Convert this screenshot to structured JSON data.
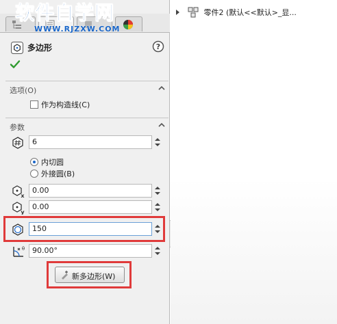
{
  "watermark": {
    "title": "软件自学网",
    "url": "WWW.RJZXW.COM"
  },
  "feature": {
    "title": "多边形"
  },
  "options": {
    "header": "选项(O)",
    "construction_label": "作为构造线(C)"
  },
  "params": {
    "header": "参数",
    "sides": "6",
    "inscribed_label": "内切圆",
    "circumscribed_label": "外接圆(B)",
    "center_x": "0.00",
    "center_y": "0.00",
    "size": "150",
    "angle": "90.00°"
  },
  "buttons": {
    "new_polygon": "新多边形(W)"
  },
  "tree": {
    "part_label": "零件2  (默认<<默认>_显..."
  },
  "colors": {
    "highlight": "#e03a3a",
    "accent": "#1a66c8",
    "ok_green": "#2e9a2e"
  }
}
